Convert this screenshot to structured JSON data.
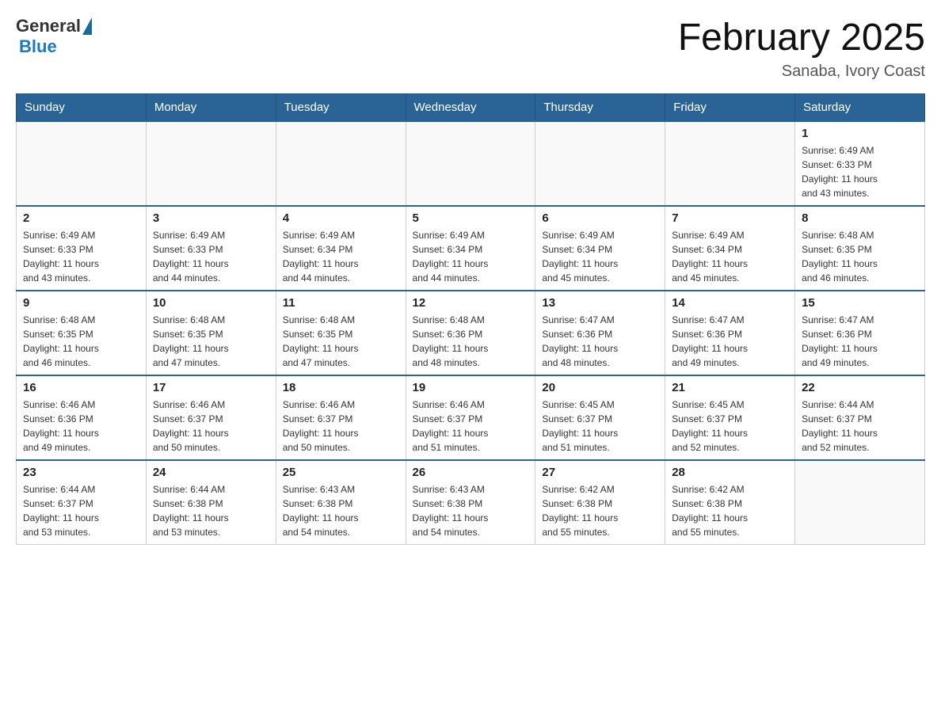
{
  "logo": {
    "general": "General",
    "blue": "Blue"
  },
  "title": "February 2025",
  "subtitle": "Sanaba, Ivory Coast",
  "days_header": [
    "Sunday",
    "Monday",
    "Tuesday",
    "Wednesday",
    "Thursday",
    "Friday",
    "Saturday"
  ],
  "weeks": [
    [
      {
        "day": "",
        "info": ""
      },
      {
        "day": "",
        "info": ""
      },
      {
        "day": "",
        "info": ""
      },
      {
        "day": "",
        "info": ""
      },
      {
        "day": "",
        "info": ""
      },
      {
        "day": "",
        "info": ""
      },
      {
        "day": "1",
        "info": "Sunrise: 6:49 AM\nSunset: 6:33 PM\nDaylight: 11 hours\nand 43 minutes."
      }
    ],
    [
      {
        "day": "2",
        "info": "Sunrise: 6:49 AM\nSunset: 6:33 PM\nDaylight: 11 hours\nand 43 minutes."
      },
      {
        "day": "3",
        "info": "Sunrise: 6:49 AM\nSunset: 6:33 PM\nDaylight: 11 hours\nand 44 minutes."
      },
      {
        "day": "4",
        "info": "Sunrise: 6:49 AM\nSunset: 6:34 PM\nDaylight: 11 hours\nand 44 minutes."
      },
      {
        "day": "5",
        "info": "Sunrise: 6:49 AM\nSunset: 6:34 PM\nDaylight: 11 hours\nand 44 minutes."
      },
      {
        "day": "6",
        "info": "Sunrise: 6:49 AM\nSunset: 6:34 PM\nDaylight: 11 hours\nand 45 minutes."
      },
      {
        "day": "7",
        "info": "Sunrise: 6:49 AM\nSunset: 6:34 PM\nDaylight: 11 hours\nand 45 minutes."
      },
      {
        "day": "8",
        "info": "Sunrise: 6:48 AM\nSunset: 6:35 PM\nDaylight: 11 hours\nand 46 minutes."
      }
    ],
    [
      {
        "day": "9",
        "info": "Sunrise: 6:48 AM\nSunset: 6:35 PM\nDaylight: 11 hours\nand 46 minutes."
      },
      {
        "day": "10",
        "info": "Sunrise: 6:48 AM\nSunset: 6:35 PM\nDaylight: 11 hours\nand 47 minutes."
      },
      {
        "day": "11",
        "info": "Sunrise: 6:48 AM\nSunset: 6:35 PM\nDaylight: 11 hours\nand 47 minutes."
      },
      {
        "day": "12",
        "info": "Sunrise: 6:48 AM\nSunset: 6:36 PM\nDaylight: 11 hours\nand 48 minutes."
      },
      {
        "day": "13",
        "info": "Sunrise: 6:47 AM\nSunset: 6:36 PM\nDaylight: 11 hours\nand 48 minutes."
      },
      {
        "day": "14",
        "info": "Sunrise: 6:47 AM\nSunset: 6:36 PM\nDaylight: 11 hours\nand 49 minutes."
      },
      {
        "day": "15",
        "info": "Sunrise: 6:47 AM\nSunset: 6:36 PM\nDaylight: 11 hours\nand 49 minutes."
      }
    ],
    [
      {
        "day": "16",
        "info": "Sunrise: 6:46 AM\nSunset: 6:36 PM\nDaylight: 11 hours\nand 49 minutes."
      },
      {
        "day": "17",
        "info": "Sunrise: 6:46 AM\nSunset: 6:37 PM\nDaylight: 11 hours\nand 50 minutes."
      },
      {
        "day": "18",
        "info": "Sunrise: 6:46 AM\nSunset: 6:37 PM\nDaylight: 11 hours\nand 50 minutes."
      },
      {
        "day": "19",
        "info": "Sunrise: 6:46 AM\nSunset: 6:37 PM\nDaylight: 11 hours\nand 51 minutes."
      },
      {
        "day": "20",
        "info": "Sunrise: 6:45 AM\nSunset: 6:37 PM\nDaylight: 11 hours\nand 51 minutes."
      },
      {
        "day": "21",
        "info": "Sunrise: 6:45 AM\nSunset: 6:37 PM\nDaylight: 11 hours\nand 52 minutes."
      },
      {
        "day": "22",
        "info": "Sunrise: 6:44 AM\nSunset: 6:37 PM\nDaylight: 11 hours\nand 52 minutes."
      }
    ],
    [
      {
        "day": "23",
        "info": "Sunrise: 6:44 AM\nSunset: 6:37 PM\nDaylight: 11 hours\nand 53 minutes."
      },
      {
        "day": "24",
        "info": "Sunrise: 6:44 AM\nSunset: 6:38 PM\nDaylight: 11 hours\nand 53 minutes."
      },
      {
        "day": "25",
        "info": "Sunrise: 6:43 AM\nSunset: 6:38 PM\nDaylight: 11 hours\nand 54 minutes."
      },
      {
        "day": "26",
        "info": "Sunrise: 6:43 AM\nSunset: 6:38 PM\nDaylight: 11 hours\nand 54 minutes."
      },
      {
        "day": "27",
        "info": "Sunrise: 6:42 AM\nSunset: 6:38 PM\nDaylight: 11 hours\nand 55 minutes."
      },
      {
        "day": "28",
        "info": "Sunrise: 6:42 AM\nSunset: 6:38 PM\nDaylight: 11 hours\nand 55 minutes."
      },
      {
        "day": "",
        "info": ""
      }
    ]
  ]
}
